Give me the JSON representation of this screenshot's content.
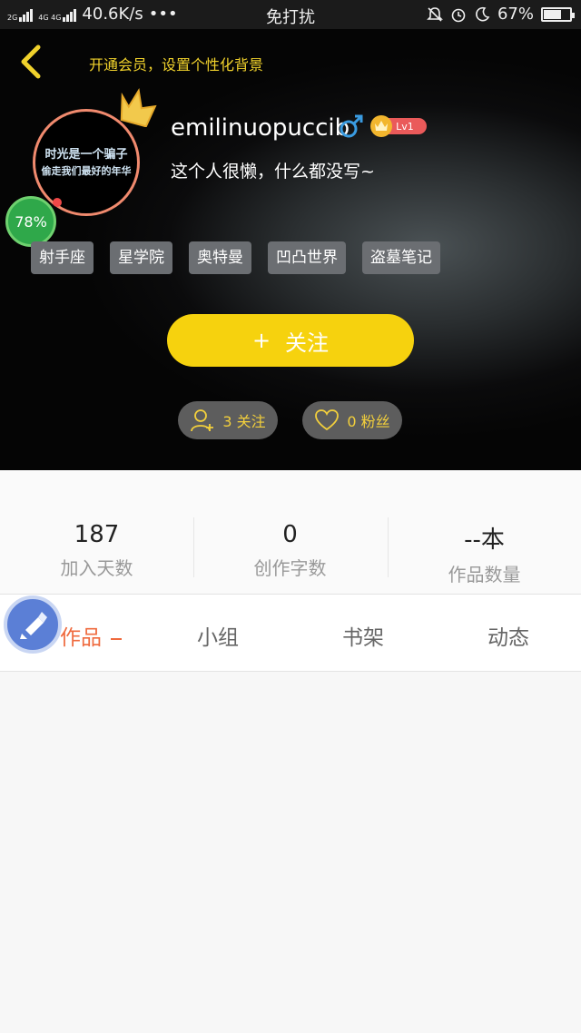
{
  "status_bar": {
    "sim1": "2G",
    "sim2": "4G 4G",
    "speed": "40.6K/s",
    "dots": "•••",
    "dnd": "免打扰",
    "battery": "67%",
    "battery_level": 0.67
  },
  "header": {
    "vip_link": "开通会员，设置个性化背景"
  },
  "profile": {
    "avatar_text_line1": "时光是一个骗子",
    "avatar_text_line2": "偷走我们最好的年华",
    "progress": "78%",
    "username": "emilinuopuccib",
    "gender_symbol": "♂",
    "level": "Lv1",
    "bio": "这个人很懒，什么都没写~",
    "tags": [
      "射手座",
      "星学院",
      "奥特曼",
      "凹凸世界",
      "盗墓笔记"
    ],
    "follow_plus": "+",
    "follow_label": "关注",
    "following": "3 关注",
    "fans": "0 粉丝"
  },
  "stats": [
    {
      "value": "187",
      "label": "加入天数"
    },
    {
      "value": "0",
      "label": "创作字数"
    },
    {
      "value": "--本",
      "label": "作品数量"
    }
  ],
  "tabs": [
    "作品",
    "小组",
    "书架",
    "动态"
  ],
  "colors": {
    "accent_yellow": "#f6d20e",
    "accent_orange": "#ef6a3e"
  }
}
